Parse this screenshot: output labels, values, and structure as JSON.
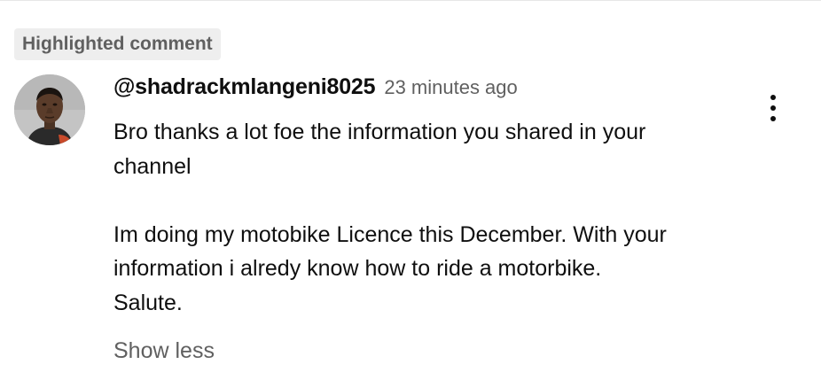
{
  "highlight_label": "Highlighted comment",
  "comment": {
    "author": "@shadrackmlangeni8025",
    "timestamp": "23 minutes ago",
    "lines": [
      "Bro thanks a lot foe the information you shared in your",
      "channel",
      "Im doing my motobike Licence this December. With your",
      "information i alredy know how to ride a motorbike.",
      "Salute."
    ],
    "show_less_label": "Show less",
    "avatar_icon": "user-avatar-photo",
    "menu_icon": "more-vert-icon"
  },
  "colors": {
    "text_primary": "#0f0f0f",
    "text_secondary": "#606060",
    "chip_background": "#eeeeee"
  }
}
